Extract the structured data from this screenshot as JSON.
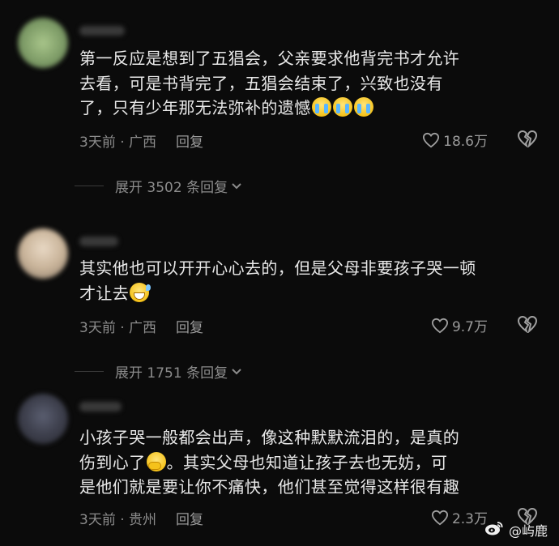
{
  "comments": [
    {
      "content_line1": "第一反应是想到了五猖会，父亲要求他背完书才允许",
      "content_line2": "去看，可是书背完了，五猖会结束了，兴致也没有",
      "content_line3": "了，只有少年那无法弥补的遗憾",
      "meta": "3天前 · 广西",
      "reply": "回复",
      "likes": "18.6万",
      "expand": "展开 3502 条回复"
    },
    {
      "content_line1": "其实他也可以开开心心去的，但是父母非要孩子哭一顿",
      "content_line2": "才让去",
      "meta": "3天前 · 广西",
      "reply": "回复",
      "likes": "9.7万",
      "expand": "展开 1751 条回复"
    },
    {
      "content_line1": "小孩子哭一般都会出声，像这种默默流泪的，是真的",
      "content_line2a": "伤到心了",
      "content_line2b": "。其实父母也知道让孩子去也无妨，可",
      "content_line3": "是他们就是要让你不痛快，他们甚至觉得这样很有趣",
      "meta": "3天前 · 贵州",
      "reply": "回复",
      "likes": "2.3万"
    }
  ],
  "watermark": "@屿鹿",
  "icons": [
    "heart-outline-icon",
    "broken-heart-icon",
    "chevron-down-icon",
    "weibo-logo-icon",
    "loudly-crying-face-emoji",
    "grinning-sweat-emoji",
    "shy-face-emoji"
  ]
}
